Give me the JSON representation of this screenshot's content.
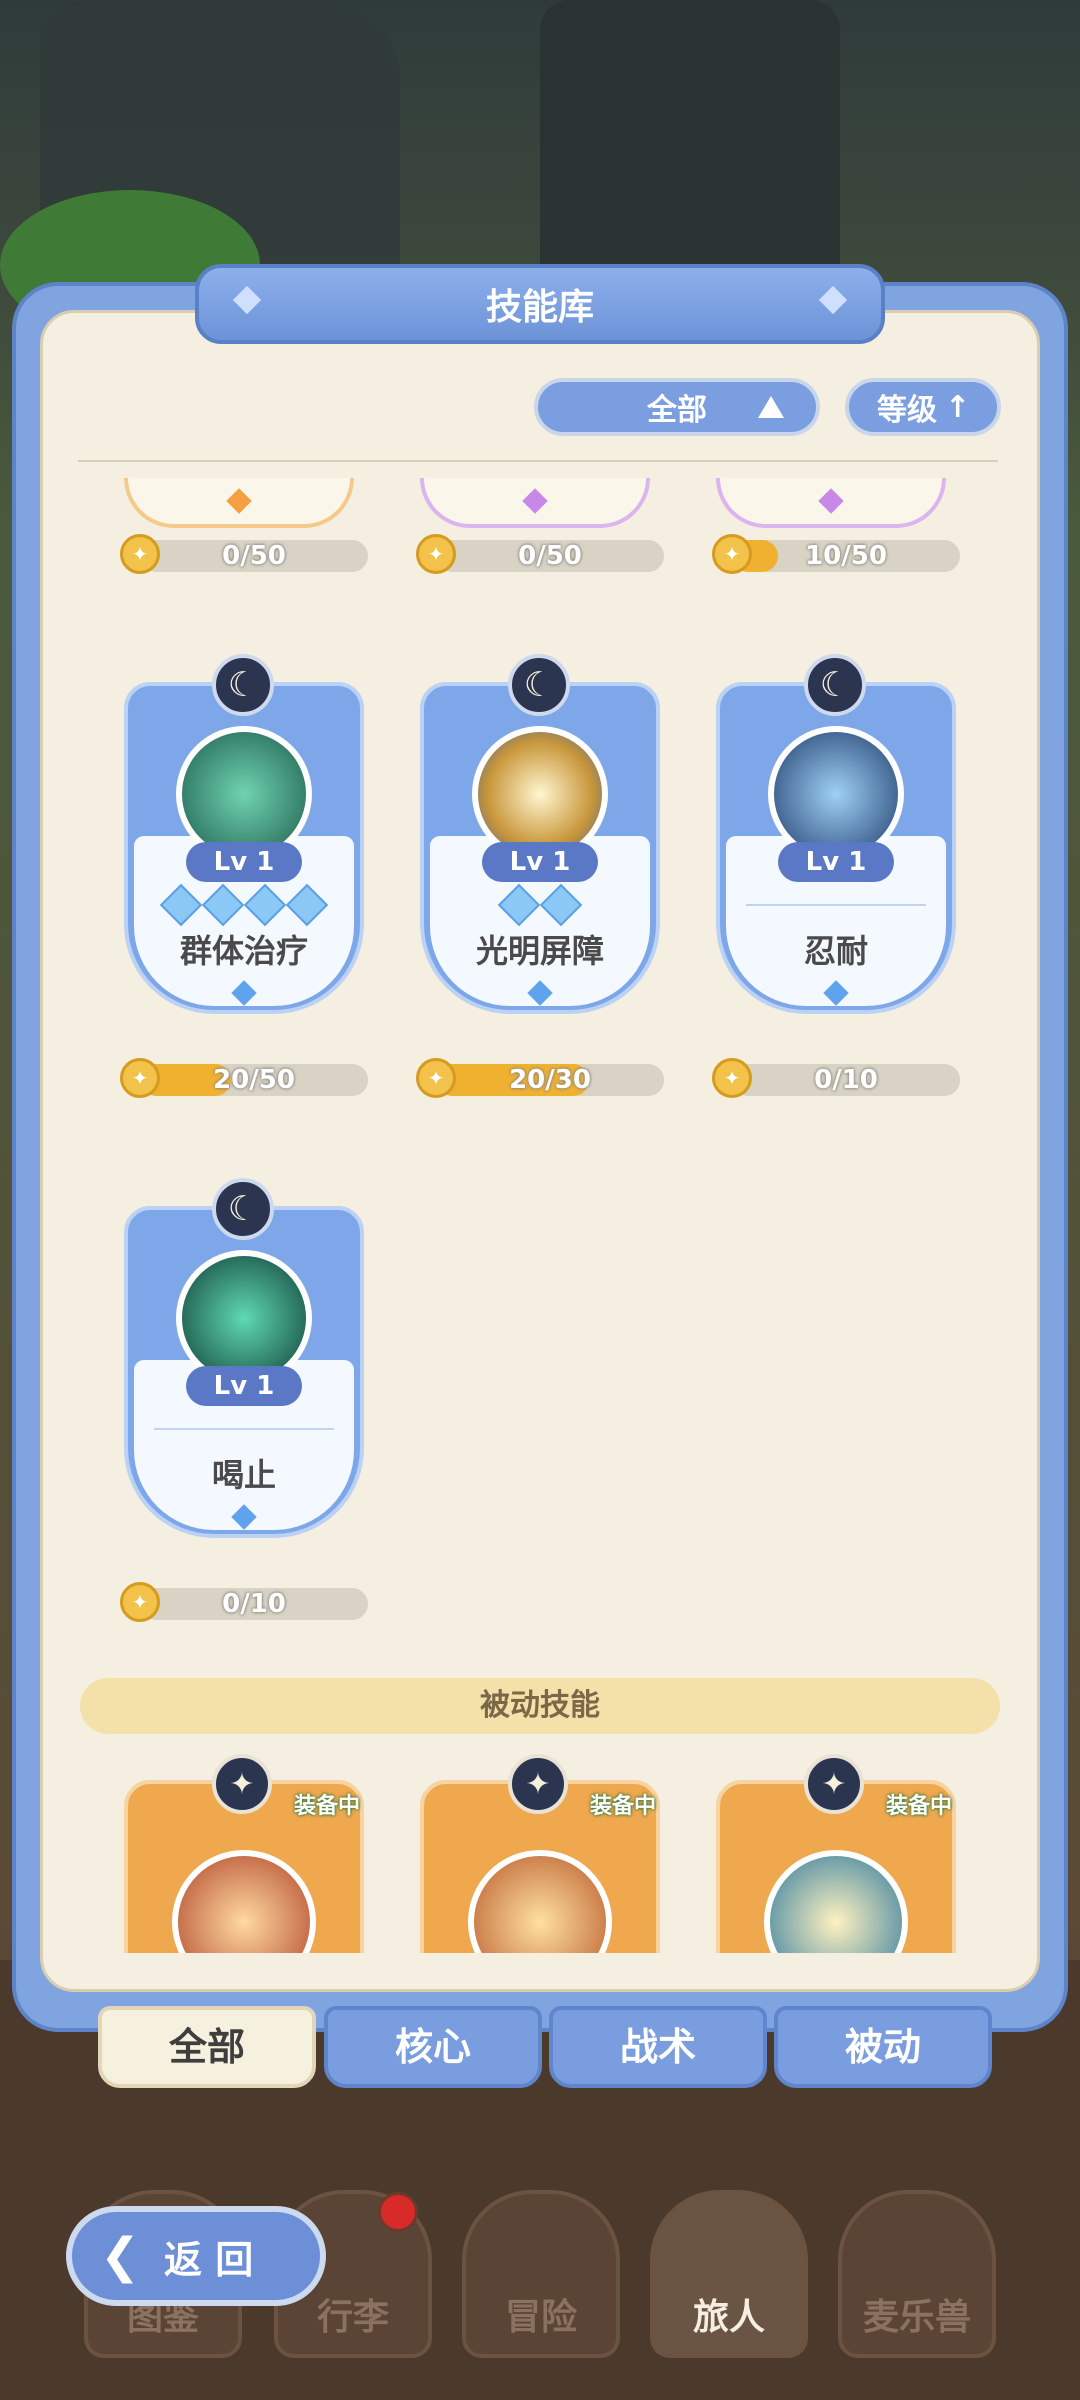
{
  "title": "技能库",
  "filters": {
    "category": "全部",
    "sort": "等级"
  },
  "top_partial_progress": [
    {
      "label": "0/50",
      "fraction": 0,
      "accent": "#f5a040"
    },
    {
      "label": "0/50",
      "fraction": 0,
      "accent": "#c788e8"
    },
    {
      "label": "10/50",
      "fraction": 0.2,
      "accent": "#c788e8"
    }
  ],
  "skills": [
    {
      "name": "群体治疗",
      "level": "Lv 1",
      "stars": 4,
      "progress_label": "20/50",
      "progress": 0.4,
      "art_color": "#2f8a70"
    },
    {
      "name": "光明屏障",
      "level": "Lv 1",
      "stars": 2,
      "progress_label": "20/30",
      "progress": 0.667,
      "art_color": "#d9b45a"
    },
    {
      "name": "忍耐",
      "level": "Lv 1",
      "stars": 0,
      "progress_label": "0/10",
      "progress": 0,
      "art_color": "#274f86"
    },
    {
      "name": "喝止",
      "level": "Lv 1",
      "stars": 0,
      "progress_label": "0/10",
      "progress": 0,
      "art_color": "#1f6a58"
    }
  ],
  "passive_section": {
    "title": "被动技能",
    "equipped_tag": "装备中"
  },
  "passive_cards": [
    {
      "tag": "装备中",
      "art_color": "#b0452a"
    },
    {
      "tag": "装备中",
      "art_color": "#b85a2a"
    },
    {
      "tag": "装备中",
      "art_color": "#2f7a9e"
    }
  ],
  "tabs": [
    "全部",
    "核心",
    "战术",
    "被动"
  ],
  "active_tab": "全部",
  "bottom_nav": [
    "图鉴",
    "行李",
    "冒险",
    "旅人",
    "麦乐兽"
  ],
  "back_label": "返 回"
}
